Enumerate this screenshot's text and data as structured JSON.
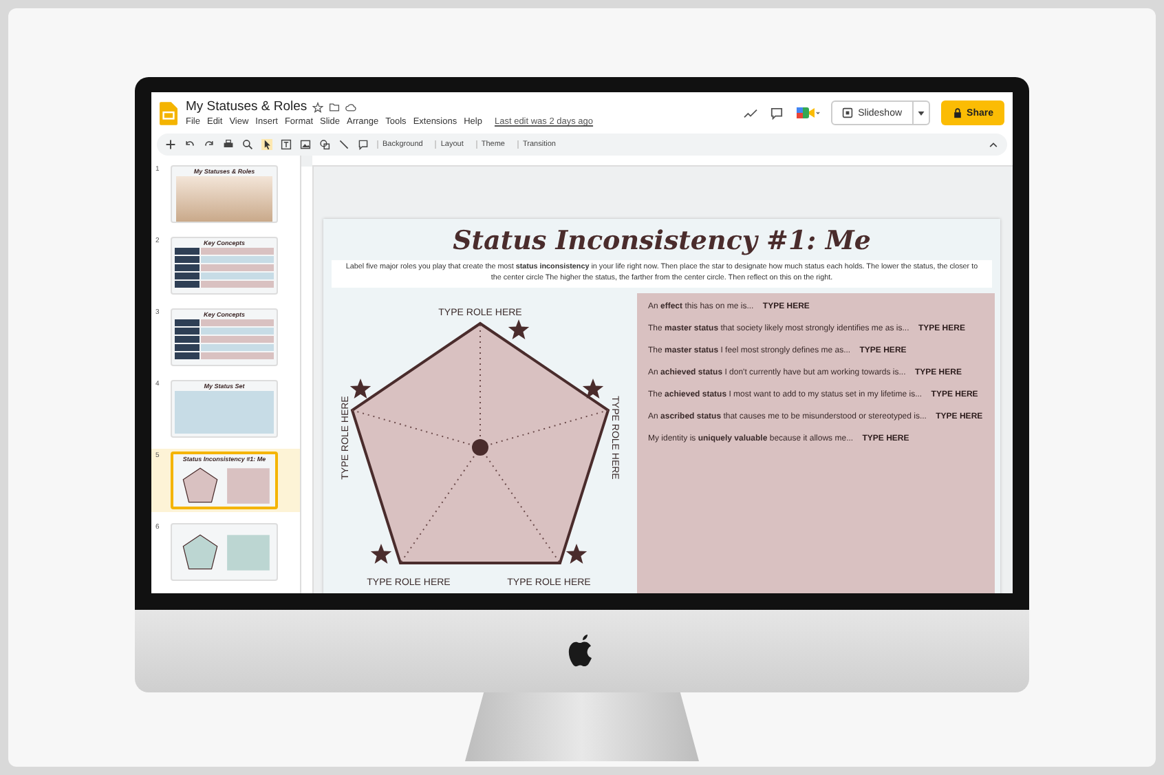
{
  "app": {
    "title": "My Statuses & Roles",
    "menus": [
      "File",
      "Edit",
      "View",
      "Insert",
      "Format",
      "Slide",
      "Arrange",
      "Tools",
      "Extensions",
      "Help"
    ],
    "last_edit": "Last edit was 2 days ago",
    "slideshow": "Slideshow",
    "share": "Share"
  },
  "toolbar": {
    "items": [
      "Background",
      "Layout",
      "Theme",
      "Transition"
    ]
  },
  "filmstrip": [
    {
      "number": "1",
      "title": "My Statuses & Roles",
      "kind": "photo",
      "color": "#c9a98a",
      "selected": false
    },
    {
      "number": "2",
      "title": "Key Concepts",
      "kind": "table",
      "color": "#d9c1c1",
      "selected": false
    },
    {
      "number": "3",
      "title": "Key Concepts",
      "kind": "table",
      "color": "#d9c1c1",
      "selected": false
    },
    {
      "number": "4",
      "title": "My Status Set",
      "kind": "list",
      "color": "#c7dce6",
      "selected": false
    },
    {
      "number": "5",
      "title": "Status Inconsistency #1: Me",
      "kind": "pentagon",
      "color": "#d9c1c1",
      "selected": true
    },
    {
      "number": "6",
      "kind": "pentagon",
      "color": "#bcd6d2",
      "selected": false
    }
  ],
  "slide": {
    "title": "Status Inconsistency #1: Me",
    "instructions": "Label five major roles you play that create the most **status inconsistency** in your life right now. Then place the star to designate how much status each holds. The lower the status, the closer to the center circle The higher the status, the farther from the center circle. Then reflect on this on the right.",
    "role_labels": [
      "TYPE ROLE HERE",
      "TYPE ROLE HERE",
      "TYPE ROLE HERE",
      "TYPE ROLE HERE",
      "TYPE ROLE HERE"
    ],
    "prompts": [
      {
        "text": "An **effect** this has on me is...",
        "answer": "TYPE HERE"
      },
      {
        "text": "The **master status** that society likely most strongly identifies me as is...",
        "answer": "TYPE HERE"
      },
      {
        "text": "The **master status** I feel most strongly defines me as...",
        "answer": "TYPE HERE"
      },
      {
        "text": "An **achieved status** I don't currently have but am working towards is...",
        "answer": "TYPE HERE"
      },
      {
        "text": "The **achieved status** I most want to add to my status set in my lifetime is...",
        "answer": "TYPE HERE"
      },
      {
        "text": "An **ascribed status** that causes me to be misunderstood or stereotyped is...",
        "answer": "TYPE HERE"
      },
      {
        "text": "My identity is **uniquely valuable** because it allows me...",
        "answer": "TYPE HERE"
      }
    ]
  }
}
